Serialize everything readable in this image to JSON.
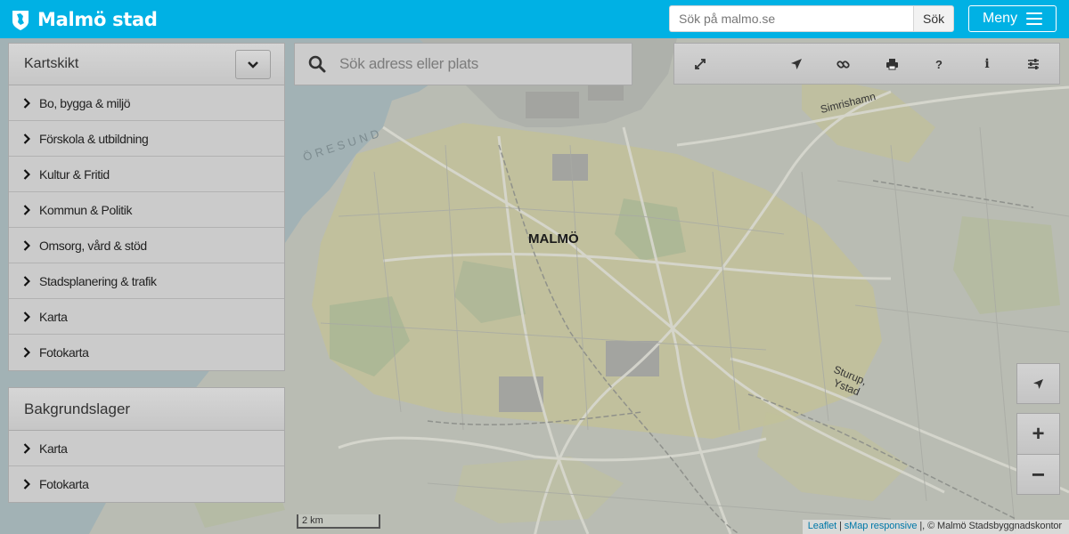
{
  "header": {
    "brand": "Malmö stad",
    "site_search_placeholder": "Sök på malmo.se",
    "site_search_button": "Sök",
    "menu_label": "Meny"
  },
  "layers_panel": {
    "title": "Kartskikt",
    "items": [
      {
        "label": "Bo, bygga & miljö"
      },
      {
        "label": "Förskola & utbildning"
      },
      {
        "label": "Kultur & Fritid"
      },
      {
        "label": "Kommun & Politik"
      },
      {
        "label": "Omsorg, vård & stöd"
      },
      {
        "label": "Stadsplanering & trafik"
      },
      {
        "label": "Karta"
      },
      {
        "label": "Fotokarta"
      }
    ]
  },
  "base_panel": {
    "title": "Bakgrundslager",
    "items": [
      {
        "label": "Karta"
      },
      {
        "label": "Fotokarta"
      }
    ]
  },
  "map_search": {
    "placeholder": "Sök adress eller plats"
  },
  "toolbar": {
    "buttons": [
      {
        "icon": "fullscreen-icon"
      },
      {
        "icon": "airplane-icon"
      },
      {
        "icon": "link-icon"
      },
      {
        "icon": "print-icon"
      },
      {
        "icon": "help-icon",
        "glyph": "?"
      },
      {
        "icon": "info-icon",
        "glyph": "i"
      },
      {
        "icon": "settings-sliders-icon"
      }
    ]
  },
  "map": {
    "labels": {
      "city": "MALMÖ",
      "sea": "ÖRESUND",
      "road_simrishamn": "Simrishamn",
      "road_sturup": "Sturup,",
      "road_ystad": "Ystad"
    },
    "scale_label": "2 km"
  },
  "zoom": {
    "in_label": "+",
    "out_label": "−"
  },
  "attribution": {
    "leaflet": "Leaflet",
    "separator": " | ",
    "smap": "sMap responsive",
    "rest": " |, © Malmö Stadsbyggnadskontor"
  },
  "colors": {
    "header": "#00b1e4",
    "panel": "#cfcfcf",
    "water": "#9fb2b8",
    "land": "#babcb2",
    "urban_yellow": "#c7c495",
    "green": "#a9b592"
  }
}
